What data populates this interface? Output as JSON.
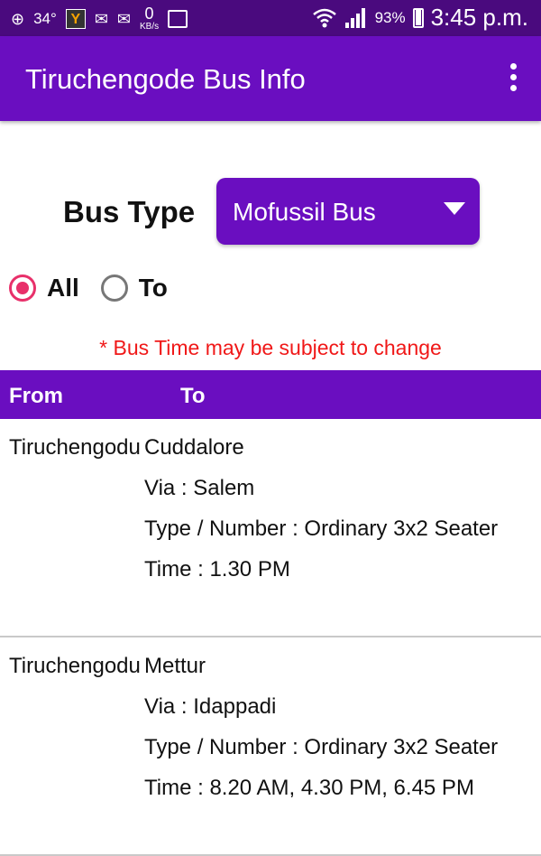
{
  "status_bar": {
    "icons_left": [
      "add-icon",
      "temperature",
      "yandex-icon",
      "mail-icon",
      "mail-icon",
      "data-speed",
      "image-icon"
    ],
    "temperature": "34°",
    "yandex_letter": "Y",
    "data_speed_value": "0",
    "data_speed_unit": "KB/s",
    "icons_right": [
      "wifi-icon",
      "signal-icon",
      "battery-charging-icon"
    ],
    "battery_percent": "93%",
    "time": "3:45 p.m."
  },
  "app_bar": {
    "title": "Tiruchengode Bus Info",
    "overflow_icon": "more-vertical-icon"
  },
  "filters": {
    "bus_type_label": "Bus Type",
    "bus_type_value": "Mofussil Bus",
    "radio_options": [
      {
        "label": "All",
        "checked": true
      },
      {
        "label": "To",
        "checked": false
      }
    ]
  },
  "notice": "* Bus Time may be subject to change",
  "table": {
    "columns": [
      "From",
      "To"
    ],
    "rows": [
      {
        "from": "Tiruchengodu",
        "to": "Cuddalore",
        "via": "Via : Salem",
        "type": "Type / Number :  Ordinary 3x2 Seater",
        "time": "Time : 1.30 PM"
      },
      {
        "from": "Tiruchengodu",
        "to": "Mettur",
        "via": "Via : Idappadi",
        "type": "Type / Number :  Ordinary 3x2 Seater",
        "time": "Time : 8.20 AM, 4.30 PM, 6.45 PM"
      }
    ]
  },
  "colors": {
    "status_bar": "#4a0a7e",
    "primary": "#6a0ec0",
    "radio_accent": "#e8306a",
    "notice_text": "#f01818"
  }
}
